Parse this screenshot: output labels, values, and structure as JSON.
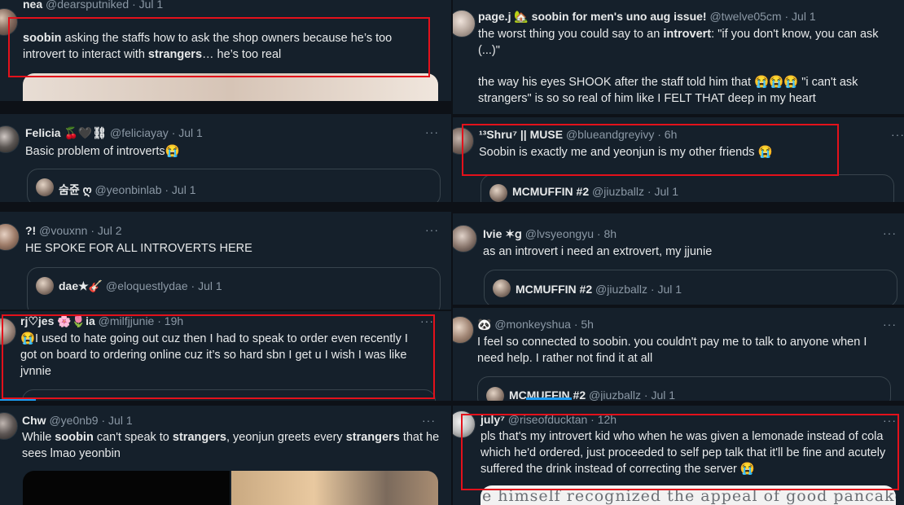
{
  "tweets": [
    {
      "name": "nea",
      "handle": "@dearsputniked",
      "date": "· Jul 1",
      "text_part1": "soobin",
      "text_part2": " asking the staffs how to ask the shop owners because he’s too introvert to interact with ",
      "text_part3": "strangers",
      "text_part4": "… he’s too real"
    },
    {
      "name": "Felicia 🍒🖤⛓",
      "handle": "@feliciayay",
      "date": "· Jul 1",
      "text": "Basic problem of introverts😭",
      "quote_name": "숨쥰 ღ",
      "quote_handle": "@yeonbinlab",
      "quote_date": "· Jul 1"
    },
    {
      "name": "?!",
      "handle": "@vouxnn",
      "date": "· Jul 2",
      "text": "HE SPOKE FOR ALL INTROVERTS HERE",
      "quote_name": "dae★🎸",
      "quote_handle": "@eloquestlydae",
      "quote_date": "· Jul 1"
    },
    {
      "name": "rj♡jes 🌸🌷ia",
      "handle": "@milfjjunie",
      "date": "· 19h",
      "text": "😭I used to hate going out cuz then I had to speak to order even recently I got on board to ordering online cuz it’s so hard sbn I get u I wish I was like jvnnie"
    },
    {
      "name": "Chw",
      "handle": "@ye0nb9",
      "date": "· Jul 1",
      "text_part1": "While ",
      "text_part2": "soobin",
      "text_part3": " can't speak to ",
      "text_part4": "strangers",
      "text_part5": ", yeonjun greets every ",
      "text_part6": "strangers",
      "text_part7": " that he sees lmao yeonbin"
    },
    {
      "name": "page.j 🏡 soobin for men's uno aug issue!",
      "handle": "@twelve05cm",
      "date": "· Jul 1",
      "text_part1": "the worst thing you could say to an ",
      "text_part2": "introvert",
      "text_part3": ": \"if you don't know, you can ask (...)\"",
      "text_part4": "the way his eyes SHOOK after the staff told him that 😭😭😭 \"i can't ask strangers\" is so so real of him like I FELT THAT deep in my heart"
    },
    {
      "name": "¹³Shru⁷ || MUSE",
      "handle": "@blueandgreyivy",
      "date": "· 6h",
      "text": "Soobin is exactly me and yeonjun is my other friends 😭",
      "quote_name": "MCMUFFIN #2",
      "quote_handle": "@jiuzballz",
      "quote_date": "· Jul 1"
    },
    {
      "name": "Ivie ✶ց",
      "handle": "@lvsyeongyu",
      "date": "· 8h",
      "text": "as an introvert i need an extrovert, my jjunie",
      "quote_name": "MCMUFFIN #2",
      "quote_handle": "@jiuzballz",
      "quote_date": "· Jul 1"
    },
    {
      "name": "🐼",
      "handle": "@monkeyshua",
      "date": "· 5h",
      "text": "I feel so connected to soobin. you couldn't pay me to talk to anyone when I need help. I rather not find it at all",
      "quote_name": "MCMUFFIN #2",
      "quote_handle": "@jiuzballz",
      "quote_date": "· Jul 1"
    },
    {
      "name": "july⁷",
      "handle": "@riseofducktan",
      "date": "· 12h",
      "text": "pls that's my introvert kid who when he was given a lemonade instead of cola which he'd ordered, just proceeded to self pep talk that it'll be fine and acutely suffered the drink instead of correcting the server 😭",
      "scan_text": "e himself recognized the appeal of good pancakes too"
    }
  ],
  "more_label": "···",
  "colors": {
    "background": "#15202b",
    "highlight_box": "#e3111b",
    "accent": "#1d9bf0"
  }
}
